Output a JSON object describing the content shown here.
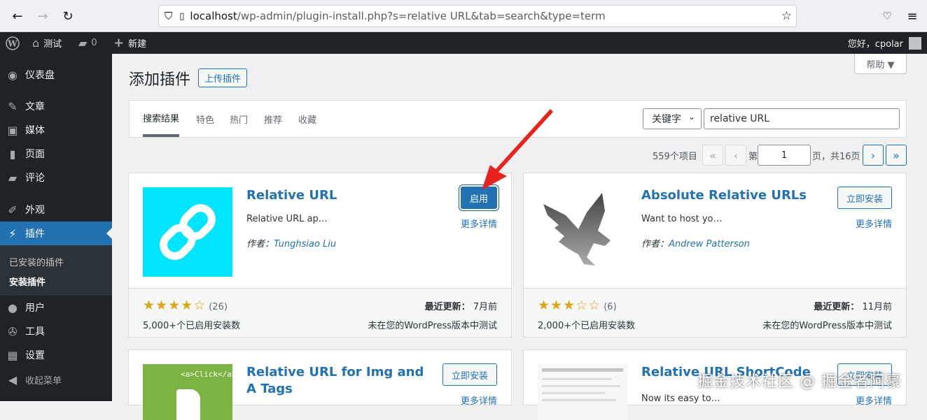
{
  "browser": {
    "url_host": "localhost",
    "url_path": "/wp-admin/plugin-install.php?s=relative URL&tab=search&type=term"
  },
  "adminbar": {
    "site_name": "测试",
    "comments_count": "0",
    "new_label": "新建",
    "greeting": "您好，cpolar"
  },
  "sidebar": {
    "items": [
      {
        "label": "仪表盘",
        "icon": "dashboard-icon"
      },
      {
        "label": "文章",
        "icon": "pin-icon"
      },
      {
        "label": "媒体",
        "icon": "media-icon"
      },
      {
        "label": "页面",
        "icon": "page-icon"
      },
      {
        "label": "评论",
        "icon": "comment-icon"
      },
      {
        "label": "外观",
        "icon": "brush-icon"
      },
      {
        "label": "插件",
        "icon": "plugin-icon"
      },
      {
        "label": "用户",
        "icon": "user-icon"
      },
      {
        "label": "工具",
        "icon": "wrench-icon"
      },
      {
        "label": "设置",
        "icon": "settings-icon"
      },
      {
        "label": "收起菜单",
        "icon": "collapse-icon"
      }
    ],
    "submenu": {
      "installed": "已安装的插件",
      "install": "安装插件"
    }
  },
  "page": {
    "title": "添加插件",
    "upload_label": "上传插件",
    "help_label": "帮助 ▼"
  },
  "filter": {
    "tabs": [
      "搜索结果",
      "特色",
      "热门",
      "推荐",
      "收藏"
    ],
    "search_type": "关键字",
    "search_value": "relative URL"
  },
  "pagination": {
    "total_items": "559个项目",
    "prefix": "第",
    "current_page": "1",
    "suffix": "页，共16页"
  },
  "plugins": [
    {
      "name": "Relative URL",
      "desc": "Relative URL ap…",
      "author_prefix": "作者：",
      "author": "Tunghsiao Liu",
      "action": "启用",
      "more": "更多详情",
      "rating": 4,
      "rating_count": "(26)",
      "installs": "5,000+个已启用安装数",
      "last_updated_label": "最近更新：",
      "last_updated": "7月前",
      "compat": "未在您的WordPress版本中测试"
    },
    {
      "name": "Absolute Relative URLs",
      "desc": "Want to host yo…",
      "author_prefix": "作者：",
      "author": "Andrew Patterson",
      "action": "立即安装",
      "more": "更多详情",
      "rating": 3,
      "rating_count": "(6)",
      "installs": "2,000+个已启用安装数",
      "last_updated_label": "最近更新：",
      "last_updated": "11月前",
      "compat": "未在您的WordPress版本中测试"
    },
    {
      "name": "Relative URL for Img and A Tags",
      "action": "立即安装",
      "more": "更多详情",
      "thumb_text": "<a>Click</a>"
    },
    {
      "name": "Relative URL ShortCode",
      "desc": "Now its easy to…",
      "action": "立即安装",
      "more": "更多详情"
    }
  ],
  "stars": {
    "filled": "★",
    "empty": "☆"
  },
  "watermark": "掘金技术社区 @ 掘金者阿豪",
  "colors": {
    "accent": "#2271b1",
    "sidebar": "#1d2327",
    "active_menu": "#2271b1",
    "star": "#dba617",
    "arrow": "#e8231d"
  }
}
